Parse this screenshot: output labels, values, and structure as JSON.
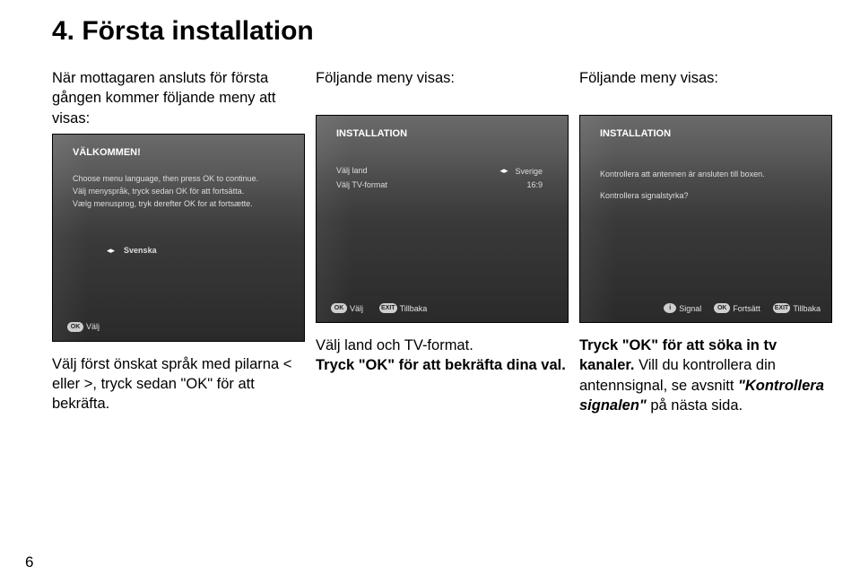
{
  "heading": "4. Första installation",
  "page_number": "6",
  "columns": [
    {
      "lead": "När mottagaren ansluts för första gången kommer följande meny att visas:",
      "caption_parts": [
        {
          "text": "Välj först önskat språk med pilarna < eller >, tryck sedan \"OK\" för att bekräfta."
        }
      ],
      "screenshot": {
        "title": "VÄLKOMMEN!",
        "lines": [
          "Choose menu language, then press OK to continue.",
          "Välj menyspråk, tryck sedan OK för att fortsätta.",
          "Vælg menusprog, tryk derefter OK for at fortsætte."
        ],
        "option": "Svenska",
        "buttons": [
          {
            "chip": "OK",
            "label": "Välj"
          }
        ]
      }
    },
    {
      "lead": "Följande meny visas:",
      "caption_parts": [
        {
          "text": "Välj land och TV-format."
        },
        {
          "text": "Tryck \"OK\" för att bekräfta dina val.",
          "bold": true
        }
      ],
      "screenshot": {
        "title": "INSTALLATION",
        "rows": [
          {
            "label": "Välj land",
            "value": "Sverige"
          },
          {
            "label": "Välj TV-format",
            "value": "16:9"
          }
        ],
        "buttons": [
          {
            "chip": "OK",
            "label": "Välj"
          },
          {
            "chip": "EXIT",
            "label": "Tillbaka"
          }
        ]
      }
    },
    {
      "lead": "Följande meny visas:",
      "caption_parts": [
        {
          "text": "Tryck \"OK\" för att söka in tv kanaler.",
          "bold": true
        },
        {
          "text": " Vill du kontrollera din antennsignal, se avsnitt "
        },
        {
          "text": "\"Kontrollera signalen\"",
          "bolditalic": true
        },
        {
          "text": " på nästa sida."
        }
      ],
      "screenshot": {
        "title": "INSTALLATION",
        "lines": [
          "Kontrollera att antennen är ansluten till boxen.",
          "Kontrollera signalstyrka?"
        ],
        "buttons": [
          {
            "chip": "i",
            "circle": true,
            "label": "Signal"
          },
          {
            "chip": "OK",
            "label": "Fortsätt"
          },
          {
            "chip": "EXIT",
            "label": "Tillbaka"
          }
        ]
      }
    }
  ]
}
